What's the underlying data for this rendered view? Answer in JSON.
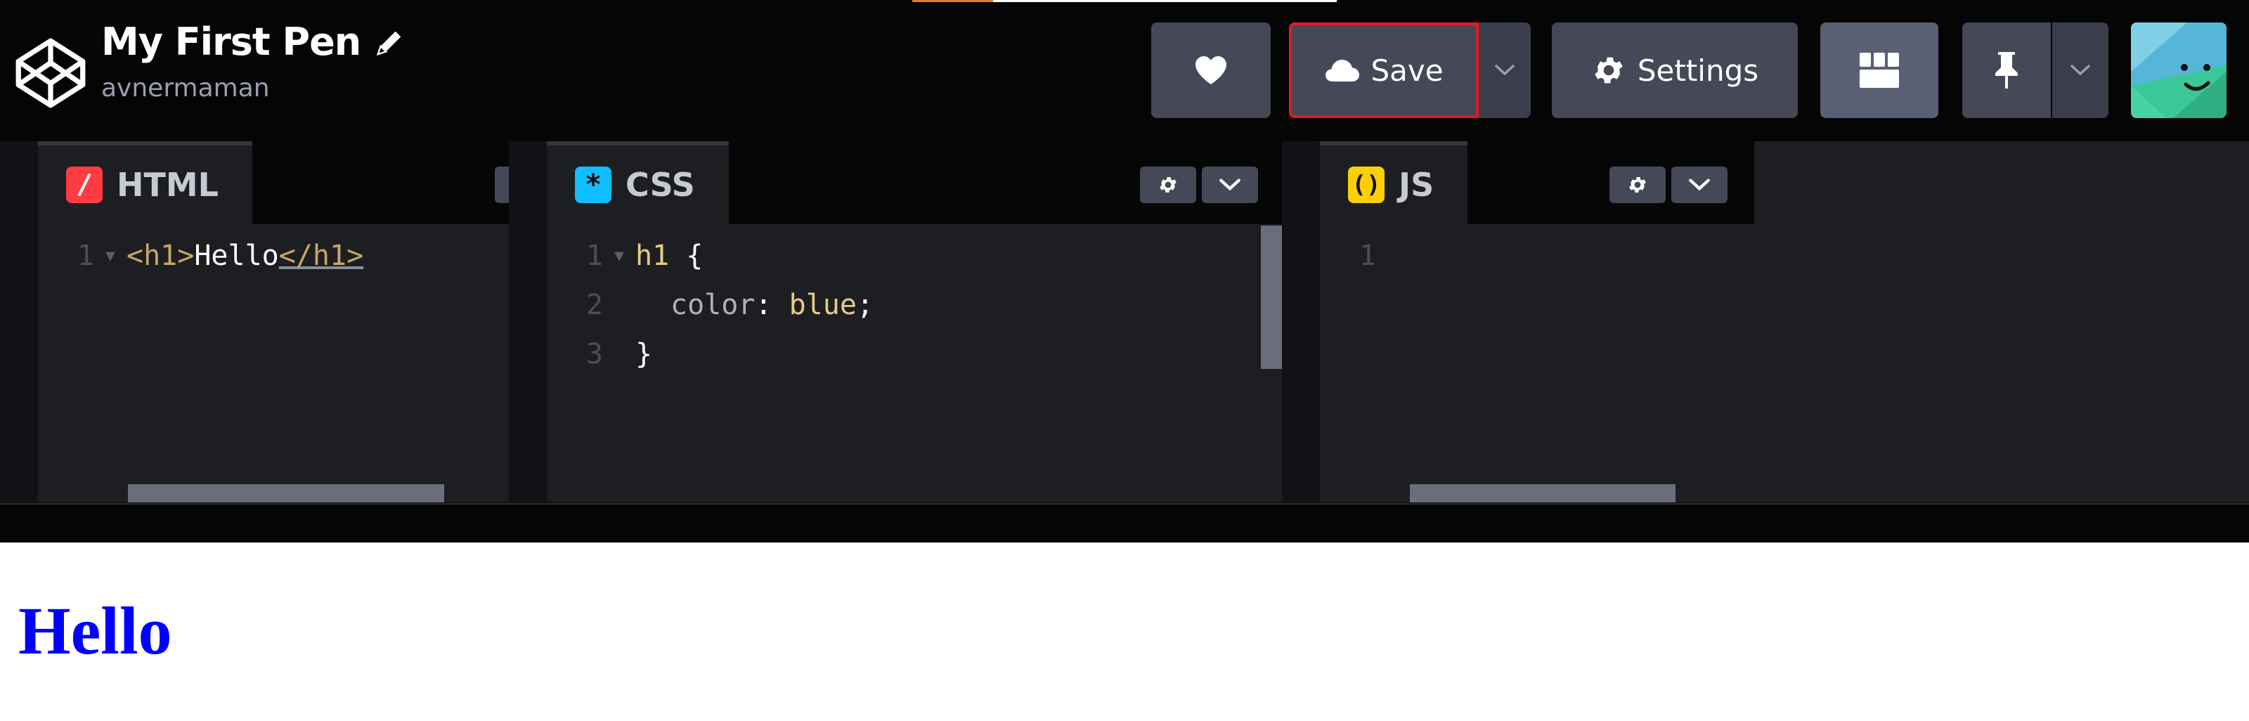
{
  "header": {
    "title": "My First Pen",
    "owner": "avnermaman",
    "save_label": "Save",
    "settings_label": "Settings",
    "progress_fraction": 0.19,
    "icons": [
      "codepen-logo-icon",
      "pencil-edit-icon",
      "heart-icon",
      "cloud-icon",
      "chevron-down-icon",
      "gear-icon",
      "layout-grid-icon",
      "pin-icon",
      "avatar"
    ]
  },
  "editors": {
    "html": {
      "label": "HTML",
      "badge_color": "#ff3c41",
      "lines": [
        {
          "num": "1",
          "open": "<h1>",
          "text": "Hello",
          "close": "</h1>"
        }
      ]
    },
    "css": {
      "label": "CSS",
      "badge_color": "#0ebeff",
      "lines": [
        {
          "num": "1",
          "selector": "h1",
          "brace_open": " {"
        },
        {
          "num": "2",
          "property": "color",
          "colon": ": ",
          "value": "blue",
          "semi": ";"
        },
        {
          "num": "3",
          "brace_close": "}"
        }
      ]
    },
    "js": {
      "label": "JS",
      "badge_color": "#fcd000",
      "lines": [
        {
          "num": "1"
        }
      ]
    }
  },
  "preview": {
    "heading": "Hello",
    "heading_color": "#0000ff"
  }
}
